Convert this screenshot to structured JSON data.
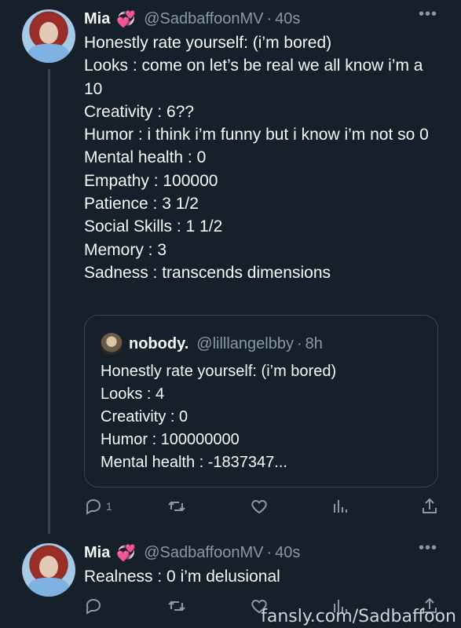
{
  "tweet1": {
    "author": {
      "name": "Mia",
      "emoji": "💞",
      "handle": "@SadbaffoonMV",
      "time": "40s"
    },
    "lines": [
      "Honestly rate yourself: (i’m bored)",
      "Looks : come on let’s be real we all know i’m a 10",
      "Creativity : 6??",
      "Humor : i think i’m funny but i know i’m not so 0",
      "Mental health : 0",
      "Empathy : 100000",
      "Patience : 3 1/2",
      "Social Skills : 1 1/2",
      "Memory : 3",
      "Sadness : transcends dimensions"
    ],
    "quote": {
      "author": {
        "name": "nobody.",
        "handle": "@lilllangelbby",
        "time": "8h"
      },
      "lines": [
        "Honestly rate yourself: (i’m bored)",
        "Looks : 4",
        "Creativity : 0",
        "Humor : 100000000",
        "Mental health : -1837347..."
      ]
    },
    "reply_count": "1"
  },
  "tweet2": {
    "author": {
      "name": "Mia",
      "emoji": "💞",
      "handle": "@SadbaffoonMV",
      "time": "40s"
    },
    "text": "Realness : 0 i’m delusional"
  },
  "watermark": "fansly.com/Sadbaffoon",
  "icons": [
    "more-icon",
    "reply-icon",
    "retweet-icon",
    "like-icon",
    "views-icon",
    "share-icon"
  ],
  "colors": {
    "background": "#15202b",
    "text": "#f7f9f9",
    "muted": "#8b98a5",
    "border": "#38444d",
    "heart": "#ff4fa3"
  }
}
